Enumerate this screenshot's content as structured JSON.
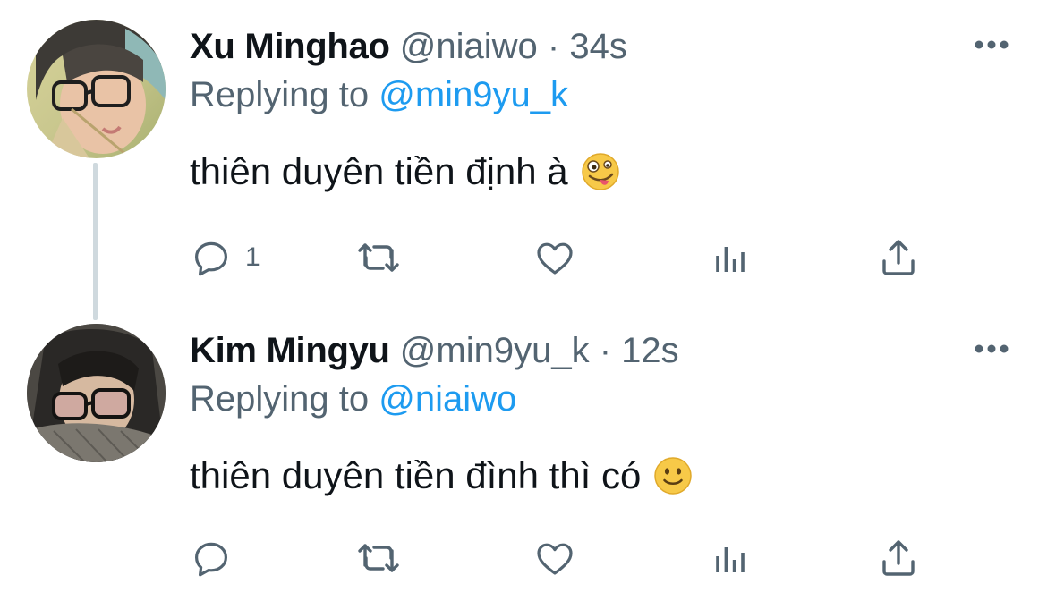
{
  "tweets": [
    {
      "name": "Xu Minghao",
      "handle": "@niaiwo",
      "separator": "·",
      "time": "34s",
      "replying_prefix": "Replying to",
      "replying_to": "@min9yu_k",
      "text": "thiên duyên tiền định à",
      "emoji": "zany-face-emoji",
      "reply_count": "1"
    },
    {
      "name": "Kim Mingyu",
      "handle": "@min9yu_k",
      "separator": "·",
      "time": "12s",
      "replying_prefix": "Replying to",
      "replying_to": "@niaiwo",
      "text": "thiên duyên tiền đình thì có",
      "emoji": "slightly-smiling-face-emoji",
      "reply_count": ""
    }
  ],
  "icons": {
    "reply": "reply-icon",
    "retweet": "retweet-icon",
    "like": "heart-icon",
    "views": "analytics-icon",
    "share": "share-icon",
    "more": "more-options-icon"
  },
  "colors": {
    "text": "#0f1419",
    "secondary": "#536471",
    "accent": "#1d9bf0",
    "thread_line": "#cfd9de"
  }
}
